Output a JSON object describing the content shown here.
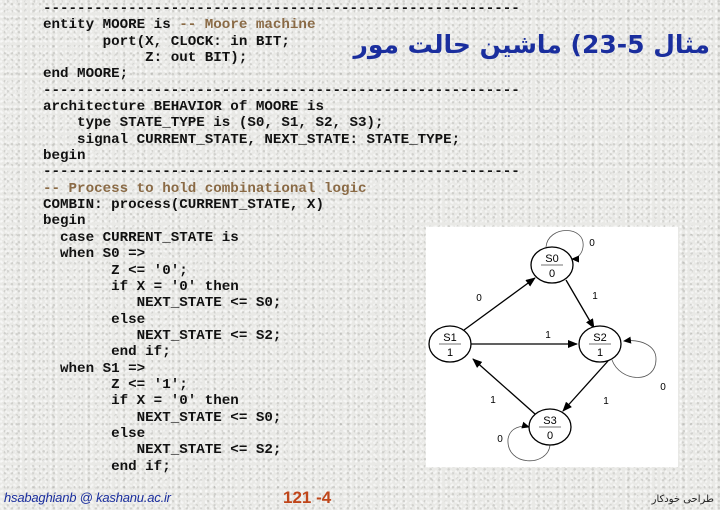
{
  "slide": {
    "title": "مثال 5-23) ماشین حالت مور",
    "footer": {
      "email": "hsabaghianb @ kashanu.ac.ir",
      "page": "121 -4",
      "course": "طراحی خودکار"
    }
  },
  "code": {
    "lines": [
      {
        "text": "--------------------------------------------------------",
        "type": "separator"
      },
      {
        "text": "entity MOORE is ",
        "type": "code",
        "comment": "-- Moore machine"
      },
      {
        "text": "       port(X, CLOCK: in BIT;",
        "type": "code"
      },
      {
        "text": "            Z: out BIT);",
        "type": "code"
      },
      {
        "text": "end MOORE;",
        "type": "code"
      },
      {
        "text": "--------------------------------------------------------",
        "type": "separator"
      },
      {
        "text": "architecture BEHAVIOR of MOORE is",
        "type": "code"
      },
      {
        "text": "    type STATE_TYPE is (S0, S1, S2, S3);",
        "type": "code"
      },
      {
        "text": "    signal CURRENT_STATE, NEXT_STATE: STATE_TYPE;",
        "type": "code"
      },
      {
        "text": "begin",
        "type": "code"
      },
      {
        "text": "--------------------------------------------------------",
        "type": "separator"
      },
      {
        "text": "",
        "type": "comment",
        "comment": "-- Process to hold combinational logic"
      },
      {
        "text": "COMBIN: process(CURRENT_STATE, X)",
        "type": "code"
      },
      {
        "text": "begin",
        "type": "code"
      },
      {
        "text": "  case CURRENT_STATE is",
        "type": "code"
      },
      {
        "text": "  when S0 =>",
        "type": "code"
      },
      {
        "text": "        Z <= '0';",
        "type": "code"
      },
      {
        "text": "        if X = '0' then",
        "type": "code"
      },
      {
        "text": "           NEXT_STATE <= S0;",
        "type": "code"
      },
      {
        "text": "        else",
        "type": "code"
      },
      {
        "text": "           NEXT_STATE <= S2;",
        "type": "code"
      },
      {
        "text": "        end if;",
        "type": "code"
      },
      {
        "text": "  when S1 =>",
        "type": "code"
      },
      {
        "text": "        Z <= '1';",
        "type": "code"
      },
      {
        "text": "        if X = '0' then",
        "type": "code"
      },
      {
        "text": "           NEXT_STATE <= S0;",
        "type": "code"
      },
      {
        "text": "        else",
        "type": "code"
      },
      {
        "text": "           NEXT_STATE <= S2;",
        "type": "code"
      },
      {
        "text": "        end if;",
        "type": "code"
      }
    ]
  },
  "state_diagram": {
    "states": [
      {
        "id": "S0",
        "name": "S0",
        "output": "0"
      },
      {
        "id": "S1",
        "name": "S1",
        "output": "1"
      },
      {
        "id": "S2",
        "name": "S2",
        "output": "1"
      },
      {
        "id": "S3",
        "name": "S3",
        "output": "0"
      }
    ],
    "transitions": [
      {
        "from": "S0",
        "to": "S0",
        "label": "0"
      },
      {
        "from": "S0",
        "to": "S2",
        "label": "1"
      },
      {
        "from": "S1",
        "to": "S0",
        "label": "0"
      },
      {
        "from": "S1",
        "to": "S2",
        "label": "1"
      },
      {
        "from": "S2",
        "to": "S2",
        "label": "0"
      },
      {
        "from": "S2",
        "to": "S3",
        "label": "1"
      },
      {
        "from": "S3",
        "to": "S1",
        "label": "1"
      },
      {
        "from": "S3",
        "to": "S3",
        "label": "0"
      }
    ]
  },
  "colors": {
    "title": "#1a2e9e",
    "comment": "#8a6a45",
    "page_number": "#c0461a"
  }
}
